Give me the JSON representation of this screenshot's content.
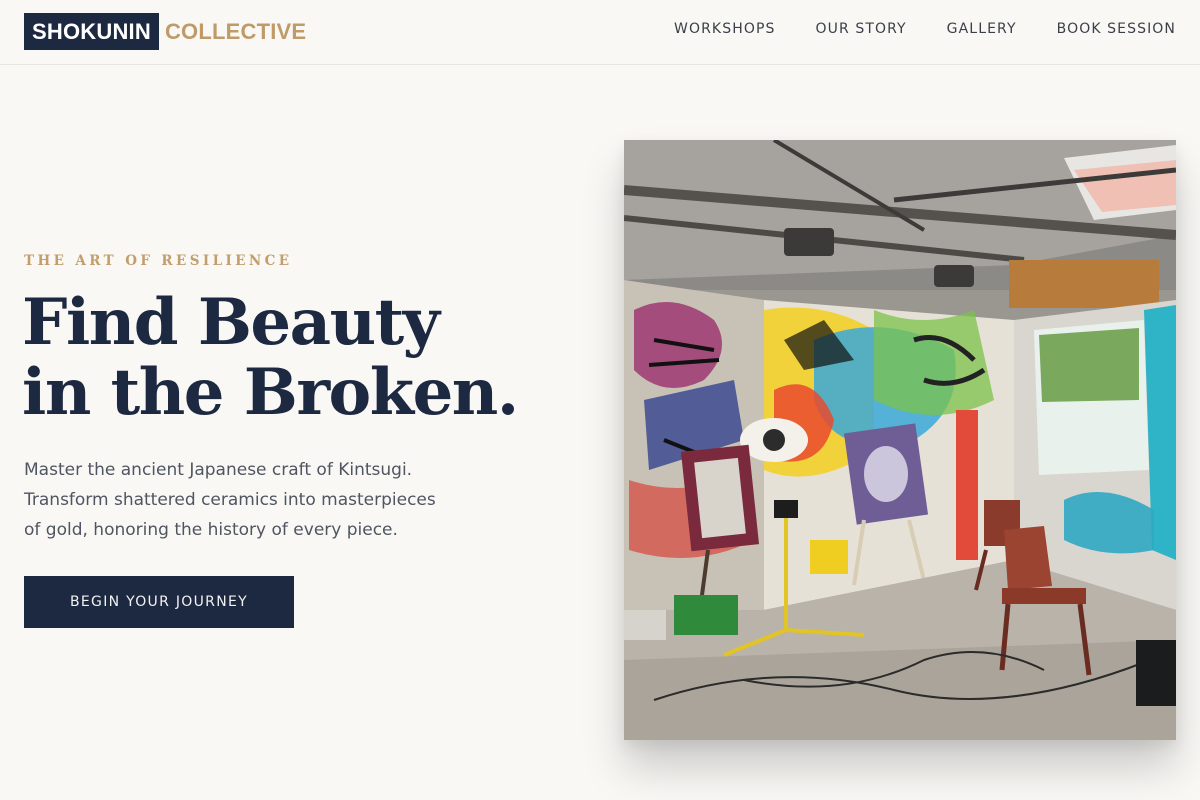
{
  "brand": {
    "name_primary": "SHOKUNIN",
    "name_secondary": "COLLECTIVE"
  },
  "nav": {
    "items": [
      "WORKSHOPS",
      "OUR STORY",
      "GALLERY",
      "BOOK SESSION"
    ]
  },
  "hero": {
    "eyebrow": "THE ART OF RESILIENCE",
    "headline_lines": [
      "Find Beauty",
      "in the Broken."
    ],
    "description_lines": [
      "Master the ancient Japanese craft of Kintsugi.",
      "Transform shattered ceramics into masterpieces",
      "of gold, honoring the history of every piece."
    ],
    "cta_label": "BEGIN YOUR JOURNEY"
  },
  "image": {
    "subject": "graffiti-covered art studio with easels, paintings, chairs and spray cans"
  },
  "colors": {
    "brand_navy": "#1d2940",
    "accent_gold": "#bf9b6a",
    "page_background": "#f9f8f5"
  }
}
